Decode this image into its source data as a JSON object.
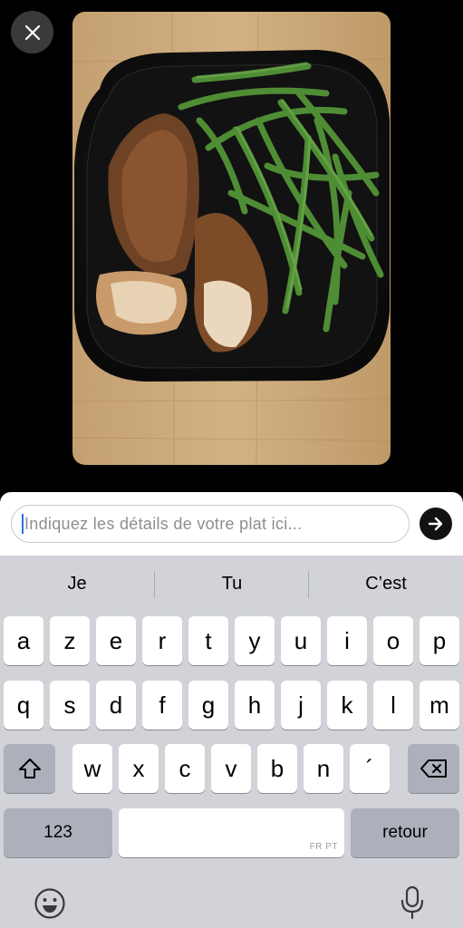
{
  "close": {
    "icon": "close-icon"
  },
  "photo": {
    "subject": "meal-photo",
    "colors": {
      "table": "#c9a875",
      "plate": "#141414",
      "beans": "#4e8a36",
      "chicken": "#7a4a2a"
    }
  },
  "input": {
    "placeholder": "Indiquez les détails de votre plat ici..."
  },
  "send": {
    "icon": "arrow-right-icon"
  },
  "suggestions": [
    "Je",
    "Tu",
    "C’est"
  ],
  "keys": {
    "row1": [
      "a",
      "z",
      "e",
      "r",
      "t",
      "y",
      "u",
      "i",
      "o",
      "p"
    ],
    "row2": [
      "q",
      "s",
      "d",
      "f",
      "g",
      "h",
      "j",
      "k",
      "l",
      "m"
    ],
    "row3": [
      "w",
      "x",
      "c",
      "v",
      "b",
      "n",
      "´"
    ],
    "numbers_label": "123",
    "return_label": "retour",
    "space_hint": "FR PT"
  },
  "icons": {
    "shift": "shift-icon",
    "backspace": "backspace-icon",
    "emoji": "emoji-icon",
    "mic": "microphone-icon"
  }
}
